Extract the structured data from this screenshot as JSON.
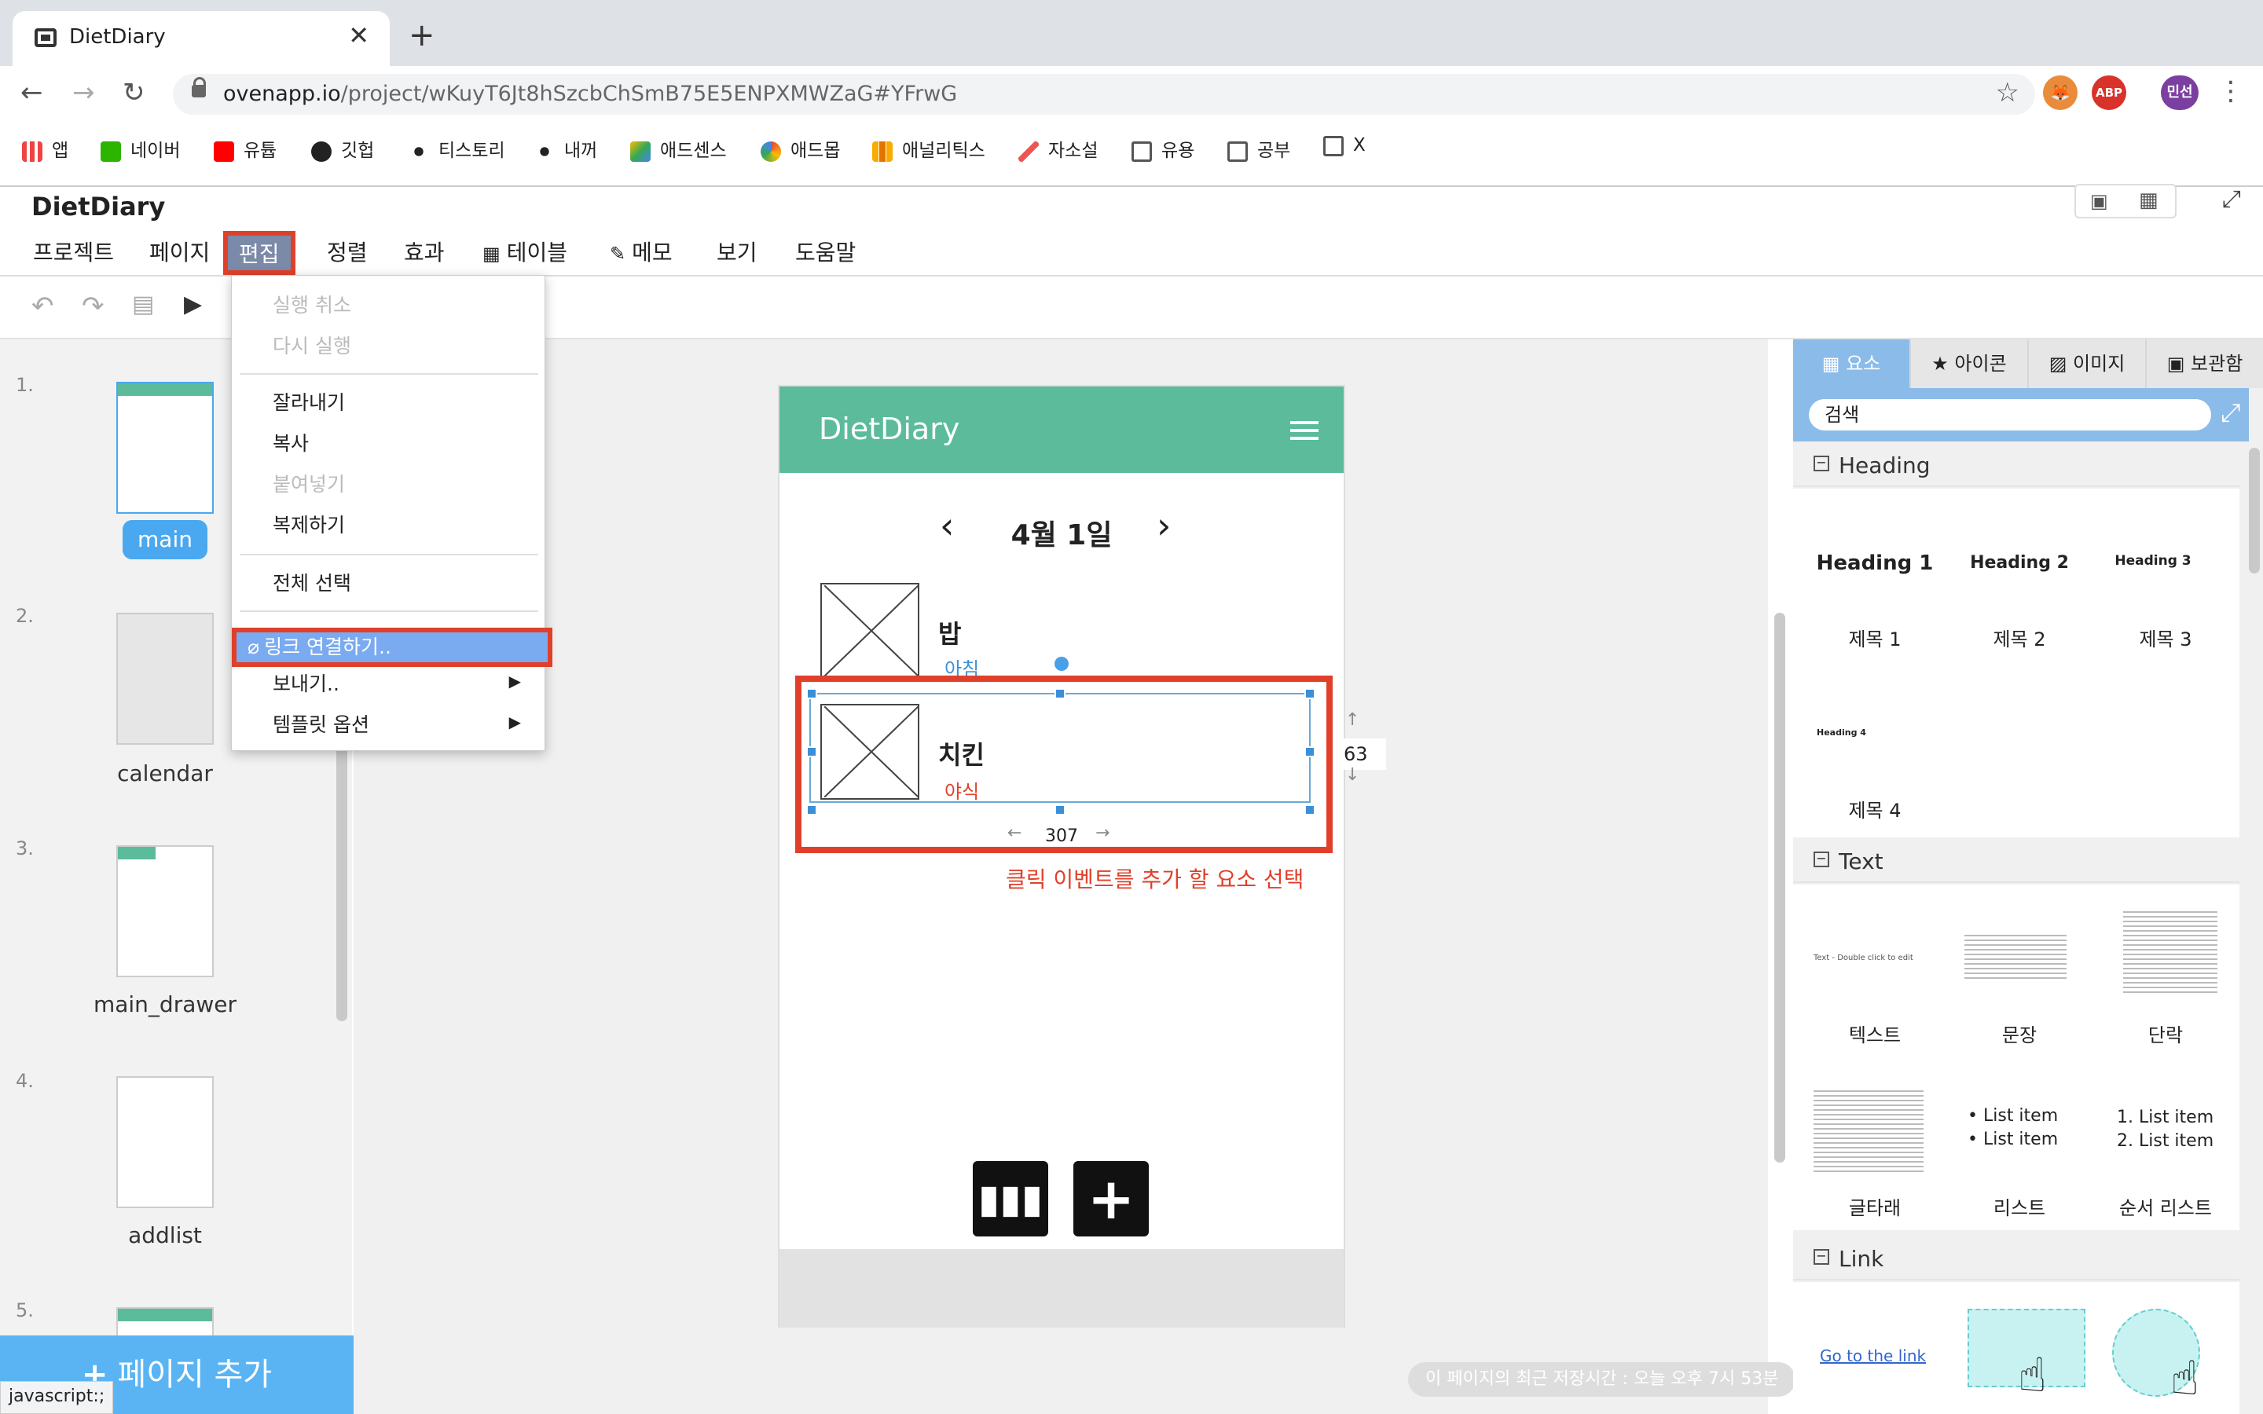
{
  "browser": {
    "tab_title": "DietDiary",
    "url_host": "ovenapp.io",
    "url_path": "/project/wKuyT6Jt8hSzcbChSmB75E5ENPXMWZaG#YFrwG",
    "profile": "민선",
    "abp": "ABP",
    "bookmarks": [
      "앱",
      "네이버",
      "유튭",
      "깃헙",
      "티스토리",
      "내꺼",
      "애드센스",
      "애드몹",
      "애널리틱스",
      "자소설",
      "유용",
      "공부",
      "X"
    ]
  },
  "app": {
    "title": "DietDiary",
    "menu": [
      "프로젝트",
      "페이지",
      "편집",
      "정렬",
      "효과",
      "테이블",
      "메모",
      "보기",
      "도움말"
    ]
  },
  "edit_menu": {
    "undo": "실행 취소",
    "redo": "다시 실행",
    "cut": "잘라내기",
    "copy": "복사",
    "paste": "붙여넣기",
    "duplicate": "복제하기",
    "select_all": "전체 선택",
    "link": "링크 연결하기..",
    "export": "보내기..",
    "template": "템플릿 옵션"
  },
  "pages": [
    {
      "num": "1.",
      "name": "main"
    },
    {
      "num": "2.",
      "name": "calendar"
    },
    {
      "num": "3.",
      "name": "main_drawer"
    },
    {
      "num": "4.",
      "name": "addlist"
    },
    {
      "num": "5.",
      "name": ""
    }
  ],
  "add_page": "페이지 추가",
  "status_url": "javascript:;",
  "phone": {
    "title": "DietDiary",
    "date": "4월 1일",
    "items": [
      {
        "food": "밥",
        "meal": "아침",
        "meal_color": "#3b8fd8"
      },
      {
        "food": "치킨",
        "meal": "야식",
        "meal_color": "#e0402a"
      }
    ],
    "dim_h": "63",
    "dim_w": "307"
  },
  "hint": "클릭 이벤트를 추가 할 요소 선택",
  "save_time": "이 페이지의 최근 저장시간 : 오늘 오후 7시 53분",
  "right_panel": {
    "tabs": [
      "요소",
      "아이콘",
      "이미지",
      "보관함"
    ],
    "search": "검색",
    "sections": {
      "heading": "Heading",
      "text": "Text",
      "link": "Link"
    },
    "heading_items": [
      {
        "preview": "Heading 1",
        "label": "제목 1"
      },
      {
        "preview": "Heading 2",
        "label": "제목 2"
      },
      {
        "preview": "Heading 3",
        "label": "제목 3"
      },
      {
        "preview": "Heading 4",
        "label": "제목 4"
      }
    ],
    "text_items": [
      "텍스트",
      "문장",
      "단락",
      "글타래",
      "리스트",
      "순서 리스트"
    ],
    "text_preview": "Text - Double click to edit",
    "list_item": "List item",
    "olist": [
      "1. List item",
      "2. List item"
    ],
    "link_preview": "Go to the link"
  },
  "colors": {
    "accent": "#5bbb9b",
    "highlight": "#e0402a",
    "selection": "#7aaaf0"
  }
}
